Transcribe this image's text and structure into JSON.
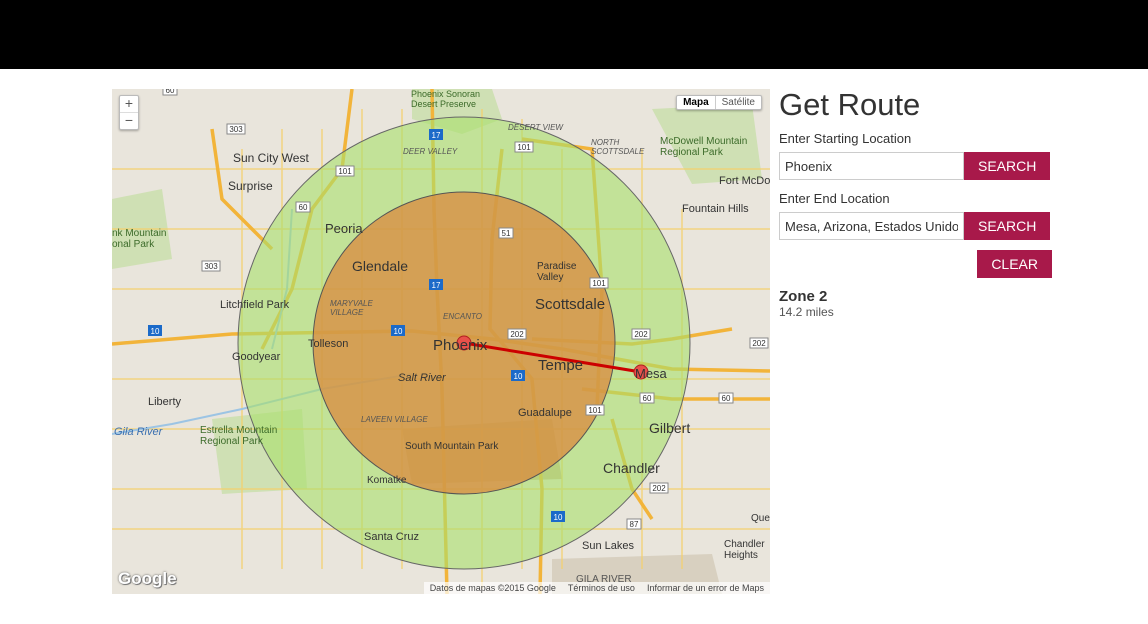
{
  "page": {
    "title": "Get Route"
  },
  "form": {
    "start_label": "Enter Starting Location",
    "start_value": "Phoenix",
    "end_label": "Enter End Location",
    "end_value": "Mesa, Arizona, Estados Unidos",
    "search_label": "SEARCH",
    "clear_label": "CLEAR"
  },
  "result": {
    "zone": "Zone 2",
    "distance": "14.2 miles"
  },
  "map": {
    "zoom_in": "+",
    "zoom_out": "−",
    "type_map": "Mapa",
    "type_satellite": "Satélite",
    "logo": "Google",
    "credits": [
      "Datos de mapas ©2015 Google",
      "Términos de uso",
      "Informar de un error de Maps"
    ],
    "places": {
      "phoenix": "Phoenix",
      "tempe": "Tempe",
      "mesa": "Mesa",
      "scottsdale": "Scottsdale",
      "glendale": "Glendale",
      "peoria": "Peoria",
      "sun_city_west": "Sun City West",
      "surprise": "Surprise",
      "goodyear": "Goodyear",
      "tolleson": "Tolleson",
      "litchfield_park": "Litchfield Park",
      "liberty": "Liberty",
      "gilbert": "Gilbert",
      "chandler": "Chandler",
      "guadalupe": "Guadalupe",
      "komatke": "Komatke",
      "santa_cruz": "Santa Cruz",
      "sun_lakes": "Sun Lakes",
      "fountain_hills": "Fountain Hills",
      "fort_mcdowell": "Fort McDowell",
      "paradise_valley": "Paradise\nValley",
      "south_mountain_park": "South Mountain Park",
      "salt_river": "Salt River",
      "gila_river": "Gila River",
      "gila_river_caps": "GILA RIVER",
      "phoenix_sonoran": "Phoenix Sonoran\nDesert Preserve",
      "mcdowell_mountain": "McDowell Mountain\nRegional Park",
      "estrella": "Estrella Mountain\nRegional Park",
      "white_tank": "nk Mountain\nonal Park",
      "deer_valley": "DEER VALLEY",
      "desert_view": "DESERT VIEW",
      "north_scottsdale": "NORTH\nSCOTTSDALE",
      "maryvale": "MARYVALE\nVILLAGE",
      "encanto": "ENCANTO",
      "laveen": "LAVEEN VILLAGE",
      "chandler_heights": "Chandler\nHeights",
      "que": "Que"
    },
    "colors": {
      "zone_outer": "#a8e06a",
      "zone_inner": "#d9893f",
      "route": "#cc0000",
      "marker": "#e8504a",
      "highway": "#f2b43a",
      "street": "#f6d06a"
    }
  }
}
